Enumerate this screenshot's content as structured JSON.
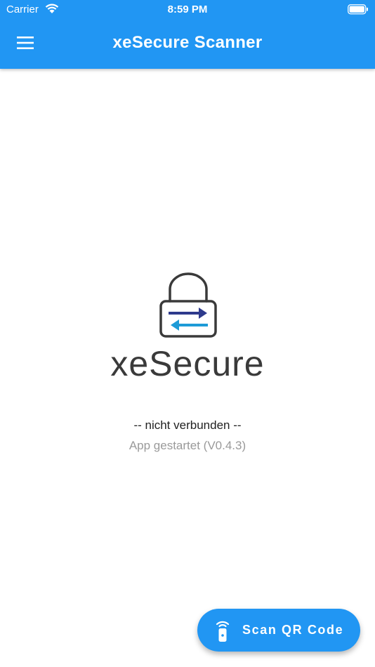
{
  "statusbar": {
    "carrier": "Carrier",
    "time": "8:59 PM"
  },
  "appbar": {
    "title": "xeSecure Scanner",
    "menu_icon": "hamburger-menu-icon"
  },
  "logo": {
    "text": "xeSecure"
  },
  "connection": {
    "status": "-- nicht verbunden --",
    "message": "App gestartet (V0.4.3)"
  },
  "fab": {
    "label": "Scan QR Code",
    "icon": "scanner-remote-icon"
  },
  "colors": {
    "primary": "#2196F3",
    "arrow_dark": "#2E3A8C",
    "arrow_light": "#1E9BD7",
    "text_muted": "#9a9a9a"
  }
}
